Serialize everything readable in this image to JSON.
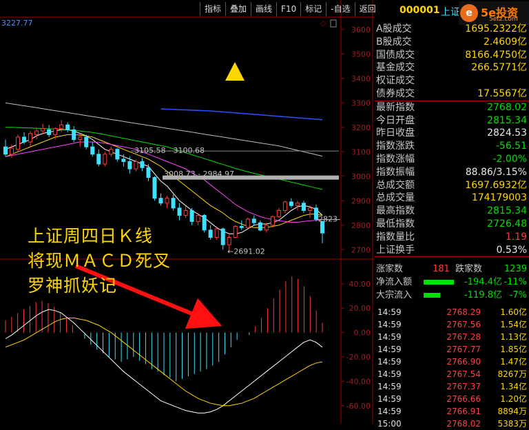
{
  "toolbar": {
    "items": [
      "指标",
      "叠加",
      "画线",
      "F10",
      "标记",
      "-自选",
      "返回"
    ]
  },
  "header": {
    "code": "000001",
    "name": "上证",
    "left_readout": "3227.77"
  },
  "logo": {
    "badge": "e",
    "text": "5e投资",
    "url": "5etz.com"
  },
  "colors": {
    "up": "#ff3b3b",
    "down": "#40e0ff",
    "ma5": "#ffffff",
    "ma10": "#ffd700",
    "ma20": "#ff40ff",
    "ma60": "#00e000",
    "ma120": "#c0c0c0",
    "ma250": "#3050ff"
  },
  "info": [
    {
      "label": "A股成交",
      "value": "1695.2322亿",
      "color": "yellow"
    },
    {
      "label": "B股成交",
      "value": "2.4609亿",
      "color": "yellow"
    },
    {
      "label": "国债成交",
      "value": "8166.4750亿",
      "color": "yellow"
    },
    {
      "label": "基金成交",
      "value": "266.5771亿",
      "color": "yellow"
    },
    {
      "label": "权证成交",
      "value": "",
      "color": "yellow"
    },
    {
      "label": "债券成交",
      "value": "17.5567亿",
      "color": "yellow"
    },
    {
      "label": "最新指数",
      "value": "2768.02",
      "color": "green"
    },
    {
      "label": "今日开盘",
      "value": "2815.34",
      "color": "green"
    },
    {
      "label": "昨日收盘",
      "value": "2824.53",
      "color": "white"
    },
    {
      "label": "指数涨跌",
      "value": "-56.51",
      "color": "green"
    },
    {
      "label": "指数涨幅",
      "value": "-2.00%",
      "color": "green"
    },
    {
      "label": "指数振幅",
      "value": "88.86/3.15%",
      "color": "white"
    },
    {
      "label": "总成交额",
      "value": "1697.6932亿",
      "color": "yellow"
    },
    {
      "label": "总成交量",
      "value": "174179003",
      "color": "yellow"
    },
    {
      "label": "最高指数",
      "value": "2815.34",
      "color": "green"
    },
    {
      "label": "最低指数",
      "value": "2726.48",
      "color": "green"
    },
    {
      "label": "指数量比",
      "value": "1.19",
      "color": "red"
    },
    {
      "label": "上证换手",
      "value": "0.53%",
      "color": "white"
    }
  ],
  "breadth": {
    "up_label": "涨家数",
    "up_value": "181",
    "down_label": "跌家数",
    "down_value": "1239"
  },
  "flow": [
    {
      "label": "净流入额",
      "value": "-194.4亿",
      "pct": "-11%"
    },
    {
      "label": "大宗流入",
      "value": "-119.8亿",
      "pct": "-7%"
    }
  ],
  "ticks": [
    {
      "time": "14:59",
      "price": "2768.29",
      "vol": "1.60亿"
    },
    {
      "time": "14:59",
      "price": "2767.56",
      "vol": "1.54亿"
    },
    {
      "time": "14:59",
      "price": "2767.28",
      "vol": "1.13亿"
    },
    {
      "time": "14:59",
      "price": "2767.77",
      "vol": "1.85亿"
    },
    {
      "time": "14:59",
      "price": "2766.90",
      "vol": "1.47亿"
    },
    {
      "time": "14:59",
      "price": "2767.54",
      "vol": "8267万"
    },
    {
      "time": "14:59",
      "price": "2767.37",
      "vol": "1.34亿"
    },
    {
      "time": "14:59",
      "price": "2766.66",
      "vol": "1.20亿"
    },
    {
      "time": "14:59",
      "price": "2766.91",
      "vol": "8894万"
    },
    {
      "time": "15:00",
      "price": "2768.02",
      "vol": "5383万"
    }
  ],
  "overlay": {
    "line1": "上证周四日Ｋ线",
    "line2": "将现ＭＡＣＤ死叉",
    "line3": "罗神抓妖记"
  },
  "chart_data": [
    {
      "type": "candlestick",
      "ylim": [
        2650,
        3650
      ],
      "y_ticks": [
        "3600",
        "3500",
        "3400",
        "3300",
        "3200",
        "3100",
        "3000",
        "2900",
        "2800",
        "2700"
      ],
      "annotations": [
        {
          "text": "3105.58 - 3100.68",
          "y": 3103
        },
        {
          "text": "3008.73 - 2984.97",
          "y": 2997
        },
        {
          "text": "2691.02",
          "y": 2691
        },
        {
          "text": "2823",
          "y": 2823
        }
      ],
      "ohlc": [
        [
          3120,
          3150,
          3080,
          3090
        ],
        [
          3090,
          3130,
          3075,
          3115
        ],
        [
          3110,
          3170,
          3100,
          3160
        ],
        [
          3160,
          3180,
          3130,
          3140
        ],
        [
          3140,
          3185,
          3120,
          3175
        ],
        [
          3170,
          3200,
          3150,
          3185
        ],
        [
          3185,
          3215,
          3170,
          3195
        ],
        [
          3190,
          3210,
          3160,
          3170
        ],
        [
          3170,
          3200,
          3150,
          3195
        ],
        [
          3195,
          3230,
          3180,
          3210
        ],
        [
          3210,
          3220,
          3180,
          3190
        ],
        [
          3190,
          3205,
          3140,
          3150
        ],
        [
          3150,
          3175,
          3120,
          3160
        ],
        [
          3160,
          3170,
          3110,
          3120
        ],
        [
          3120,
          3140,
          3080,
          3090
        ],
        [
          3090,
          3110,
          3040,
          3050
        ],
        [
          3050,
          3100,
          3040,
          3090
        ],
        [
          3090,
          3120,
          3080,
          3110
        ],
        [
          3110,
          3115,
          3060,
          3070
        ],
        [
          3070,
          3090,
          3040,
          3060
        ],
        [
          3060,
          3080,
          3010,
          3030
        ],
        [
          3030,
          3070,
          3020,
          3060
        ],
        [
          3060,
          3075,
          3020,
          3035
        ],
        [
          3035,
          3050,
          2980,
          2995
        ],
        [
          2995,
          3000,
          2900,
          2910
        ],
        [
          2910,
          2930,
          2880,
          2890
        ],
        [
          2890,
          2920,
          2870,
          2910
        ],
        [
          2910,
          2925,
          2860,
          2870
        ],
        [
          2870,
          2890,
          2820,
          2840
        ],
        [
          2840,
          2880,
          2830,
          2860
        ],
        [
          2860,
          2870,
          2800,
          2815
        ],
        [
          2815,
          2850,
          2800,
          2840
        ],
        [
          2840,
          2845,
          2770,
          2780
        ],
        [
          2780,
          2800,
          2740,
          2750
        ],
        [
          2750,
          2790,
          2740,
          2785
        ],
        [
          2785,
          2790,
          2700,
          2720
        ],
        [
          2720,
          2760,
          2691,
          2750
        ],
        [
          2750,
          2800,
          2745,
          2795
        ],
        [
          2795,
          2820,
          2780,
          2790
        ],
        [
          2790,
          2830,
          2785,
          2825
        ],
        [
          2825,
          2840,
          2800,
          2810
        ],
        [
          2810,
          2820,
          2775,
          2780
        ],
        [
          2780,
          2810,
          2770,
          2800
        ],
        [
          2800,
          2840,
          2790,
          2835
        ],
        [
          2835,
          2870,
          2830,
          2860
        ],
        [
          2860,
          2900,
          2850,
          2895
        ],
        [
          2895,
          2910,
          2870,
          2880
        ],
        [
          2880,
          2900,
          2860,
          2890
        ],
        [
          2890,
          2900,
          2850,
          2860
        ],
        [
          2860,
          2880,
          2830,
          2870
        ],
        [
          2870,
          2885,
          2815,
          2824
        ],
        [
          2815,
          2815,
          2726,
          2768
        ]
      ],
      "ma_lines": [
        {
          "name": "MA5",
          "values": [
            3110,
            3120,
            3130,
            3140,
            3150,
            3165,
            3175,
            3180,
            3185,
            3190,
            3190,
            3185,
            3175,
            3165,
            3150,
            3130,
            3110,
            3100,
            3090,
            3080,
            3070,
            3060,
            3050,
            3040,
            3010,
            2980,
            2960,
            2930,
            2900,
            2880,
            2860,
            2845,
            2830,
            2810,
            2790,
            2775,
            2765,
            2765,
            2770,
            2785,
            2800,
            2805,
            2805,
            2810,
            2820,
            2840,
            2860,
            2875,
            2880,
            2875,
            2865,
            2840
          ]
        },
        {
          "name": "MA10",
          "values": [
            3080,
            3090,
            3100,
            3110,
            3120,
            3130,
            3140,
            3150,
            3160,
            3165,
            3170,
            3170,
            3168,
            3165,
            3160,
            3150,
            3140,
            3130,
            3120,
            3110,
            3100,
            3090,
            3080,
            3070,
            3055,
            3040,
            3020,
            3000,
            2980,
            2960,
            2940,
            2920,
            2900,
            2880,
            2865,
            2850,
            2830,
            2815,
            2805,
            2795,
            2790,
            2790,
            2790,
            2795,
            2800,
            2810,
            2820,
            2830,
            2840,
            2845,
            2845,
            2840
          ]
        },
        {
          "name": "MA20",
          "values": [
            3080,
            3085,
            3090,
            3095,
            3100,
            3105,
            3110,
            3115,
            3120,
            3125,
            3130,
            3135,
            3140,
            3140,
            3140,
            3138,
            3135,
            3130,
            3125,
            3120,
            3115,
            3110,
            3100,
            3090,
            3080,
            3070,
            3060,
            3050,
            3040,
            3030,
            3015,
            3000,
            2985,
            2965,
            2945,
            2925,
            2905,
            2885,
            2870,
            2855,
            2845,
            2835,
            2828,
            2822,
            2818,
            2815,
            2812,
            2812,
            2815,
            2818,
            2820,
            2822
          ]
        },
        {
          "name": "MA60",
          "values": [
            3200,
            3200,
            3199,
            3198,
            3197,
            3196,
            3195,
            3194,
            3193,
            3192,
            3190,
            3188,
            3185,
            3182,
            3179,
            3175,
            3170,
            3165,
            3160,
            3155,
            3150,
            3145,
            3140,
            3135,
            3130,
            3125,
            3120,
            3112,
            3104,
            3096,
            3088,
            3080,
            3072,
            3064,
            3056,
            3048,
            3040,
            3032,
            3025,
            3018,
            3012,
            3006,
            3000,
            2994,
            2988,
            2982,
            2976,
            2970,
            2964,
            2958,
            2952,
            2946
          ]
        },
        {
          "name": "MA120",
          "values": [
            3300,
            3296,
            3292,
            3288,
            3284,
            3280,
            3276,
            3272,
            3268,
            3264,
            3260,
            3256,
            3252,
            3248,
            3244,
            3240,
            3236,
            3232,
            3228,
            3224,
            3220,
            3216,
            3212,
            3208,
            3204,
            3200,
            3196,
            3192,
            3188,
            3184,
            3180,
            3176,
            3172,
            3168,
            3164,
            3160,
            3156,
            3152,
            3148,
            3144,
            3140,
            3136,
            3132,
            3128,
            3124,
            3118,
            3112,
            3106,
            3100,
            3094,
            3088,
            3082
          ]
        },
        {
          "name": "MA250",
          "start": 25,
          "values": [
            3275,
            3274,
            3273,
            3272,
            3271,
            3270,
            3269,
            3268,
            3267,
            3265,
            3263,
            3261,
            3259,
            3257,
            3255,
            3253,
            3251,
            3249,
            3247,
            3245,
            3243,
            3241,
            3239,
            3237,
            3235,
            3233,
            3231
          ]
        }
      ]
    },
    {
      "type": "bar",
      "name": "MACD",
      "ylim": [
        -72,
        58
      ],
      "y_ticks": [
        "40.00",
        "20.00",
        "0.00",
        "-20.00",
        "-40.00",
        "-60.00"
      ],
      "macd": [
        10,
        13,
        16,
        19,
        22,
        25,
        26,
        24,
        21,
        17,
        12,
        6,
        0,
        -5,
        -10,
        -14,
        -17,
        -20,
        -22,
        -24,
        -22,
        -20,
        -23,
        -26,
        -30,
        -32,
        -35,
        -37,
        -40,
        -38,
        -36,
        -34,
        -32,
        -30,
        -27,
        -24,
        -18,
        -12,
        -6,
        0,
        -2,
        5,
        12,
        20,
        28,
        35,
        42,
        46,
        44,
        38,
        30,
        18,
        8
      ],
      "dif": [
        -5,
        -2,
        2,
        6,
        10,
        14,
        17,
        19,
        18,
        16,
        12,
        8,
        3,
        -2,
        -7,
        -12,
        -17,
        -22,
        -27,
        -32,
        -36,
        -40,
        -44,
        -48,
        -52,
        -56,
        -58,
        -60,
        -62,
        -64,
        -65,
        -66,
        -66,
        -65,
        -63,
        -60,
        -56,
        -52,
        -48,
        -44,
        -40,
        -36,
        -32,
        -28,
        -24,
        -20,
        -16,
        -12,
        -8,
        -6,
        -8,
        -12
      ],
      "dea": [
        -12,
        -10,
        -8,
        -6,
        -3,
        0,
        3,
        6,
        9,
        11,
        12,
        12,
        11,
        10,
        8,
        6,
        3,
        0,
        -4,
        -8,
        -12,
        -16,
        -20,
        -24,
        -28,
        -32,
        -36,
        -40,
        -44,
        -48,
        -51,
        -54,
        -56,
        -58,
        -59,
        -60,
        -60,
        -59,
        -58,
        -56,
        -54,
        -51,
        -48,
        -45,
        -42,
        -39,
        -36,
        -33,
        -30,
        -27,
        -25,
        -24
      ]
    }
  ]
}
